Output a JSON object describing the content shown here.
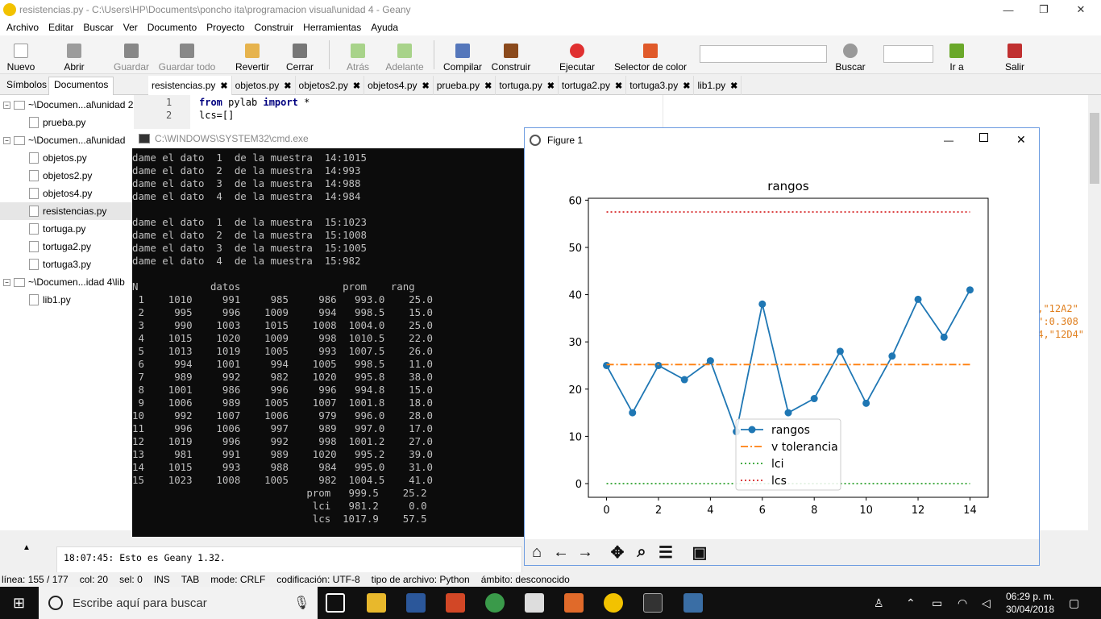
{
  "window": {
    "title": "resistencias.py - C:\\Users\\HP\\Documents\\poncho ita\\programacion visual\\unidad 4 - Geany",
    "min": "—",
    "max": "❐",
    "close": "✕"
  },
  "menu": [
    "Archivo",
    "Editar",
    "Buscar",
    "Ver",
    "Documento",
    "Proyecto",
    "Construir",
    "Herramientas",
    "Ayuda"
  ],
  "toolbar": {
    "nuevo": "Nuevo",
    "abrir": "Abrir",
    "guardar": "Guardar",
    "guardar_todo": "Guardar todo",
    "revertir": "Revertir",
    "cerrar": "Cerrar",
    "atras": "Atrás",
    "adelante": "Adelante",
    "compilar": "Compilar",
    "construir": "Construir",
    "ejecutar": "Ejecutar",
    "selector": "Selector de color",
    "buscar": "Buscar",
    "ir_a": "Ir a",
    "salir": "Salir"
  },
  "sidebar": {
    "tab_simbolos": "Símbolos",
    "tab_documentos": "Documentos",
    "tree": [
      {
        "label": "~\\Documen...al\\unidad 2",
        "kind": "dir"
      },
      {
        "label": "prueba.py",
        "kind": "file"
      },
      {
        "label": "~\\Documen...al\\unidad",
        "kind": "dir"
      },
      {
        "label": "objetos.py",
        "kind": "file"
      },
      {
        "label": "objetos2.py",
        "kind": "file"
      },
      {
        "label": "objetos4.py",
        "kind": "file"
      },
      {
        "label": "resistencias.py",
        "kind": "file"
      },
      {
        "label": "tortuga.py",
        "kind": "file"
      },
      {
        "label": "tortuga2.py",
        "kind": "file"
      },
      {
        "label": "tortuga3.py",
        "kind": "file"
      },
      {
        "label": "~\\Documen...idad 4\\lib",
        "kind": "dir"
      },
      {
        "label": "lib1.py",
        "kind": "file"
      }
    ]
  },
  "tabs": [
    "resistencias.py",
    "objetos.py",
    "objetos2.py",
    "objetos4.py",
    "prueba.py",
    "tortuga.py",
    "tortuga2.py",
    "tortuga3.py",
    "lib1.py"
  ],
  "editor": {
    "ln1": "1",
    "ln2": "2",
    "code1_kw1": "from",
    "code1_mid": " pylab ",
    "code1_kw2": "import",
    "code1_end": " *",
    "code2": "lcs=[]",
    "frag1": "5,\"12A2\"",
    "frag2": "8\":0.308",
    "frag3": "44,\"12D4\""
  },
  "cmd": {
    "title": "C:\\WINDOWS\\SYSTEM32\\cmd.exe",
    "lines": [
      "dame el dato  1  de la muestra  14:1015",
      "dame el dato  2  de la muestra  14:993",
      "dame el dato  3  de la muestra  14:988",
      "dame el dato  4  de la muestra  14:984",
      "",
      "dame el dato  1  de la muestra  15:1023",
      "dame el dato  2  de la muestra  15:1008",
      "dame el dato  3  de la muestra  15:1005",
      "dame el dato  4  de la muestra  15:982",
      "",
      "N            datos                 prom    rang",
      " 1    1010     991     985     986   993.0    25.0",
      " 2     995     996    1009     994   998.5    15.0",
      " 3     990    1003    1015    1008  1004.0    25.0",
      " 4    1015    1020    1009     998  1010.5    22.0",
      " 5    1013    1019    1005     993  1007.5    26.0",
      " 6     994    1001     994    1005   998.5    11.0",
      " 7     989     992     982    1020   995.8    38.0",
      " 8    1001     986     996     996   994.8    15.0",
      " 9    1006     989    1005    1007  1001.8    18.0",
      "10     992    1007    1006     979   996.0    28.0",
      "11     996    1006     997     989   997.0    17.0",
      "12    1019     996     992     998  1001.2    27.0",
      "13     981     991     989    1020   995.2    39.0",
      "14    1015     993     988     984   995.0    31.0",
      "15    1023    1008    1005     982  1004.5    41.0",
      "                             prom   999.5    25.2",
      "                              lci   981.2     0.0",
      "                              lcs  1017.9    57.5"
    ]
  },
  "figure": {
    "title": "Figure 1"
  },
  "chart_data": {
    "type": "line",
    "title": "rangos",
    "x": [
      0,
      1,
      2,
      3,
      4,
      5,
      6,
      7,
      8,
      9,
      10,
      11,
      12,
      13,
      14
    ],
    "xticks": [
      "0",
      "2",
      "4",
      "6",
      "8",
      "10",
      "12",
      "14"
    ],
    "yticks": [
      "0",
      "10",
      "20",
      "30",
      "40",
      "50",
      "60"
    ],
    "xlim": [
      -0.7,
      14.7
    ],
    "ylim": [
      -2.9,
      60.4
    ],
    "series": [
      {
        "name": "rangos",
        "values": [
          25,
          15,
          25,
          22,
          26,
          11,
          38,
          15,
          18,
          28,
          17,
          27,
          39,
          31,
          41
        ],
        "color": "#1f77b4",
        "style": "solid-markers"
      },
      {
        "name": "v tolerancia",
        "values": [
          25.2,
          25.2,
          25.2,
          25.2,
          25.2,
          25.2,
          25.2,
          25.2,
          25.2,
          25.2,
          25.2,
          25.2,
          25.2,
          25.2,
          25.2
        ],
        "color": "#ff7f0e",
        "style": "dashdot"
      },
      {
        "name": "lci",
        "values": [
          0,
          0,
          0,
          0,
          0,
          0,
          0,
          0,
          0,
          0,
          0,
          0,
          0,
          0,
          0
        ],
        "color": "#2ca02c",
        "style": "dotted"
      },
      {
        "name": "lcs",
        "values": [
          57.5,
          57.5,
          57.5,
          57.5,
          57.5,
          57.5,
          57.5,
          57.5,
          57.5,
          57.5,
          57.5,
          57.5,
          57.5,
          57.5,
          57.5
        ],
        "color": "#d62728",
        "style": "dotted"
      }
    ],
    "legend": "lower-center"
  },
  "messages": {
    "line": "18:07:45: Esto es Geany 1.32."
  },
  "status": [
    "línea: 155 / 177",
    "col: 20",
    "sel: 0",
    "INS",
    "TAB",
    "mode: CRLF",
    "codificación: UTF-8",
    "tipo de archivo: Python",
    "ámbito: desconocido"
  ],
  "taskbar": {
    "search": "Escribe aquí para buscar",
    "time": "06:29 p. m.",
    "date": "30/04/2018"
  }
}
